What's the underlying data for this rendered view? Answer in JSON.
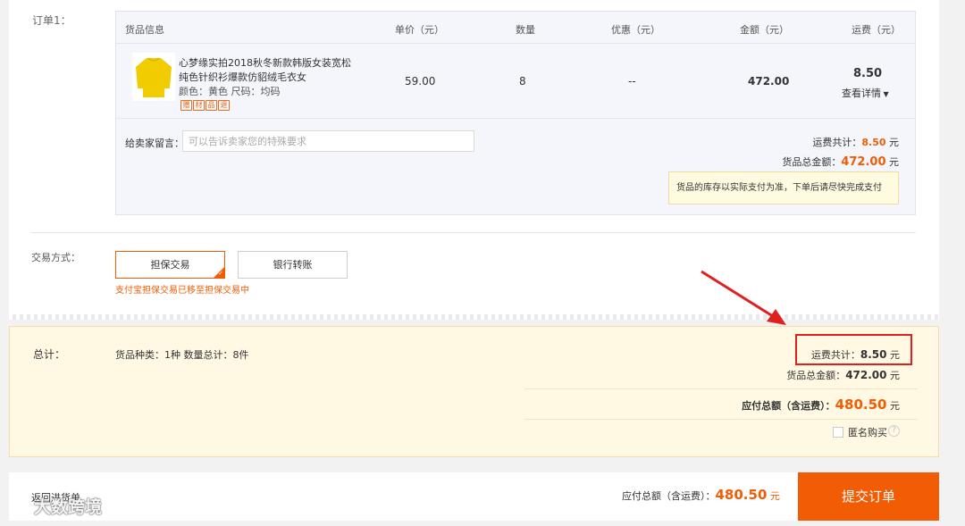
{
  "order": {
    "label": "订单1：",
    "headers": {
      "product": "货品信息",
      "unit_price": "单价（元）",
      "quantity": "数量",
      "discount": "优惠（元）",
      "amount": "金额（元）",
      "shipping": "运费（元）"
    },
    "item": {
      "title_line1": "心梦缘实拍2018秋冬新款韩版女装宽松",
      "title_line2": "纯色针织衫爆款仿貂绒毛衣女",
      "spec": "颜色：黄色    尺码：均码",
      "service_icons": [
        "赠",
        "材",
        "品",
        "退"
      ],
      "unit_price": "59.00",
      "quantity": "8",
      "discount": "--",
      "amount": "472.00",
      "shipping": "8.50",
      "shipping_detail": "查看详情"
    },
    "message_label": "给卖家留言：",
    "message_placeholder": "可以告诉卖家您的特殊要求",
    "shipping_total_label": "运费共计：",
    "shipping_total": "8.50",
    "goods_total_label": "货品总金额：",
    "goods_total": "472.00",
    "currency": "元",
    "notice": "货品的库存以实际支付为准，下单后请尽快完成支付"
  },
  "payment": {
    "label": "交易方式：",
    "options": [
      "担保交易",
      "银行转账"
    ],
    "selected": "担保交易",
    "note": "支付宝担保交易已移至担保交易中"
  },
  "summary": {
    "label": "总计：",
    "counts": "货品种类：1种   数量总计：8件",
    "shipping_total_label": "运费共计：",
    "shipping_total": "8.50",
    "goods_total_label": "货品总金额：",
    "goods_total": "472.00",
    "payable_label": "应付总额（含运费）：",
    "payable": "480.50",
    "currency": "元",
    "anonymous_label": "匿名购买",
    "help": "?"
  },
  "footer": {
    "back_link": "返回进货单",
    "payable_label": "应付总额（含运费）：",
    "payable": "480.50",
    "currency": "元",
    "submit": "提交订单"
  },
  "watermark": "大数跨境",
  "colors": {
    "accent": "#f25c05",
    "highlight_box": "#e02020",
    "summary_bg": "#fff8e3"
  }
}
